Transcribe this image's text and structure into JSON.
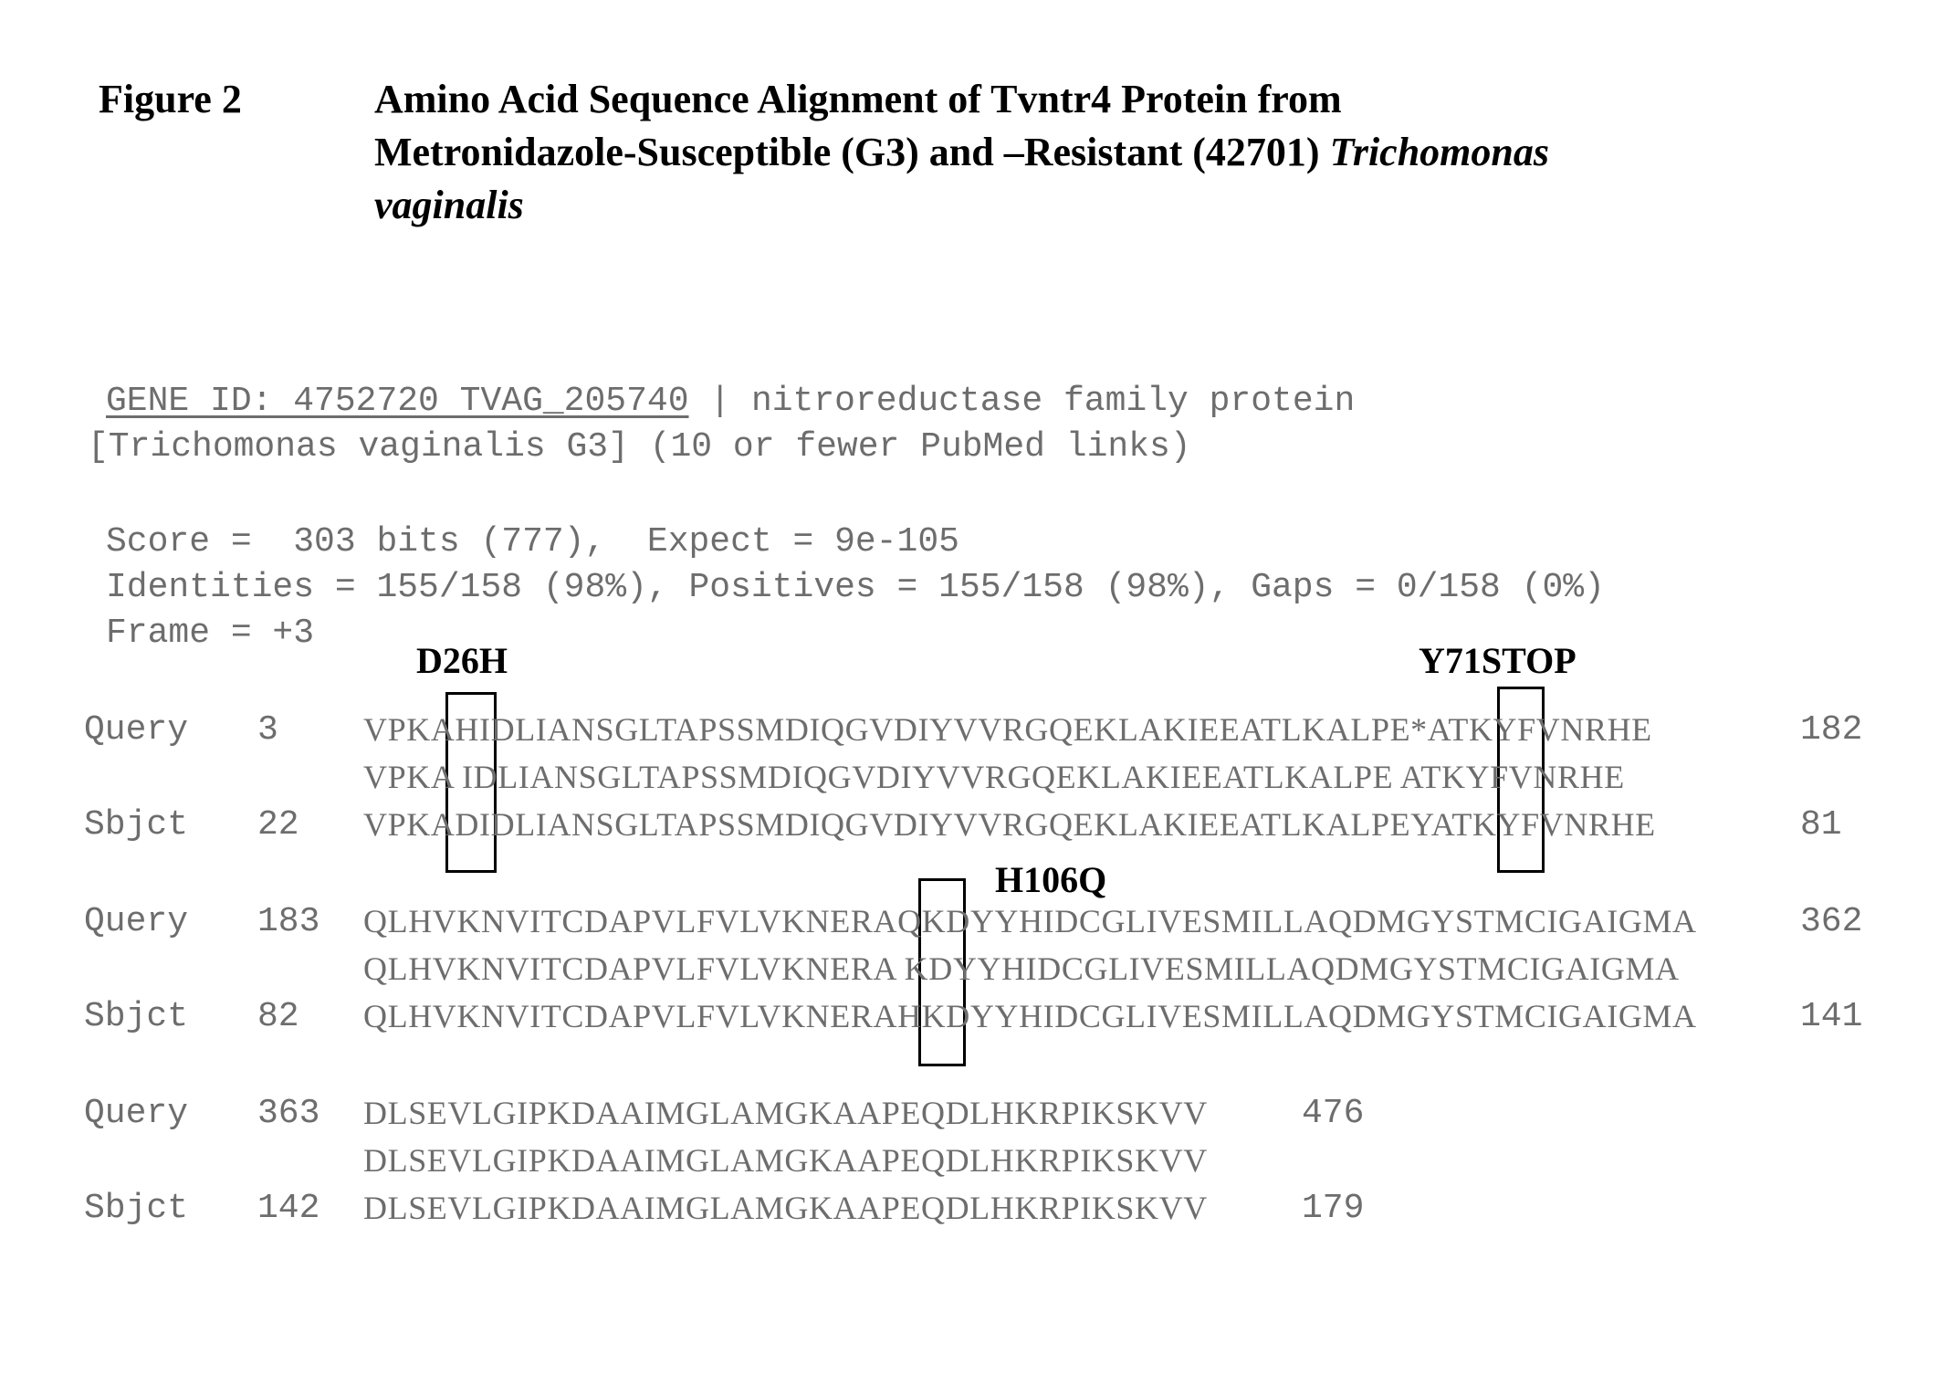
{
  "figure": {
    "label": "Figure 2",
    "title_lines": [
      "Amino Acid Sequence Alignment of Tvntr4 Protein from",
      "Metronidazole-Susceptible (G3) and –Resistant (42701) "
    ],
    "title_italic_1": "Trichomonas",
    "title_italic_2": "vaginalis"
  },
  "blast_header": {
    "gene_link": "GENE ID: 4752720 TVAG_205740",
    "separator": " | ",
    "description": "nitroreductase family protein",
    "organism_line": "[Trichomonas vaginalis G3] (10 or fewer PubMed links)",
    "score_line": "Score =  303 bits (777),  Expect = 9e-105",
    "identities_line": "Identities = 155/158 (98%), Positives = 155/158 (98%), Gaps = 0/158 (0%)",
    "frame_line": "Frame = +3"
  },
  "annotations": {
    "mut1": "D26H",
    "mut2": "Y71STOP",
    "mut3": "H106Q"
  },
  "alignment": [
    {
      "query": {
        "label": "Query",
        "start": "3",
        "seq": "VPKAHIDLIANSGLTAPSSMDIQGVDIYVVRGQEKLAKIEEATLKALPE*ATKYFVNRHE",
        "end": "182"
      },
      "match": "VPKA IDLIANSGLTAPSSMDIQGVDIYVVRGQEKLAKIEEATLKALPE ATKYFVNRHE",
      "sbjct": {
        "label": "Sbjct",
        "start": "22",
        "seq": "VPKADIDLIANSGLTAPSSMDIQGVDIYVVRGQEKLAKIEEATLKALPEYATKYFVNRHE",
        "end": "81"
      }
    },
    {
      "query": {
        "label": "Query",
        "start": "183",
        "seq": "QLHVKNVITCDAPVLFVLVKNERAQKDYYHIDCGLIVESMILLAQDMGYSTMCIGAIGMA",
        "end": "362"
      },
      "match": "QLHVKNVITCDAPVLFVLVKNERA KDYYHIDCGLIVESMILLAQDMGYSTMCIGAIGMA",
      "sbjct": {
        "label": "Sbjct",
        "start": "82",
        "seq": "QLHVKNVITCDAPVLFVLVKNERAHKDYYHIDCGLIVESMILLAQDMGYSTMCIGAIGMA",
        "end": "141"
      }
    },
    {
      "query": {
        "label": "Query",
        "start": "363",
        "seq": "DLSEVLGIPKDAAIMGLAMGKAAPEQDLHKRPIKSKVV",
        "end": "476"
      },
      "match": "DLSEVLGIPKDAAIMGLAMGKAAPEQDLHKRPIKSKVV",
      "sbjct": {
        "label": "Sbjct",
        "start": "142",
        "seq": "DLSEVLGIPKDAAIMGLAMGKAAPEQDLHKRPIKSKVV",
        "end": "179"
      }
    }
  ]
}
